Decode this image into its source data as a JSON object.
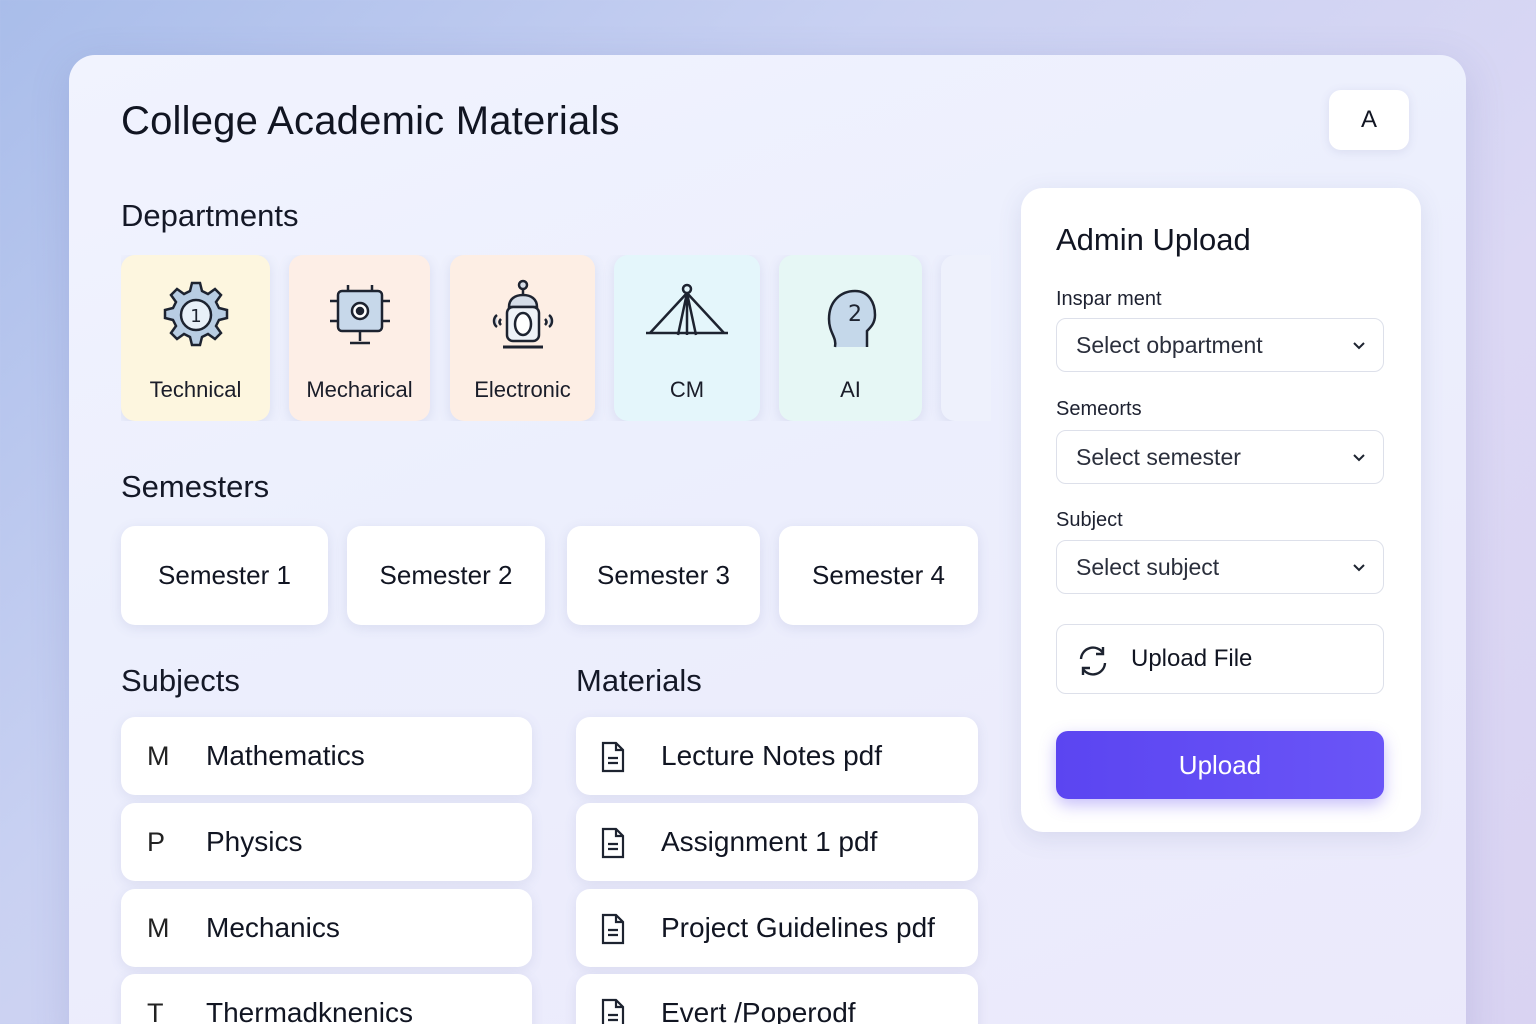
{
  "header": {
    "title": "College Academic Materials",
    "avatar_initial": "A"
  },
  "sections": {
    "departments": "Departments",
    "semesters": "Semesters",
    "subjects": "Subjects",
    "materials": "Materials"
  },
  "departments": [
    {
      "label": "Technical",
      "icon": "gear-icon",
      "bg": "#fdf6df"
    },
    {
      "label": "Mecharical",
      "icon": "machine-icon",
      "bg": "#fdeee6"
    },
    {
      "label": "Electronic",
      "icon": "robot-icon",
      "bg": "#fdeee4"
    },
    {
      "label": "CM",
      "icon": "tripod-icon",
      "bg": "#e4f6fb"
    },
    {
      "label": "AI",
      "icon": "head-icon",
      "bg": "#e6f7f5"
    }
  ],
  "semesters": [
    "Semester 1",
    "Semester 2",
    "Semester 3",
    "Semester 4"
  ],
  "subjects": [
    {
      "letter": "M",
      "name": "Mathematics"
    },
    {
      "letter": "P",
      "name": "Physics"
    },
    {
      "letter": "M",
      "name": "Mechanics"
    },
    {
      "letter": "T",
      "name": "Thermadknenics"
    }
  ],
  "materials": [
    {
      "name": "Lecture Notes pdf",
      "icon": "document-icon"
    },
    {
      "name": "Assignment 1 pdf",
      "icon": "document-icon"
    },
    {
      "name": "Project Guidelines pdf",
      "icon": "document-icon"
    },
    {
      "name": "Evert /Poperodf",
      "icon": "document-icon"
    }
  ],
  "admin": {
    "title": "Admin Upload",
    "department_label": "Inspar ment",
    "department_placeholder": "Select obpartment",
    "semester_label": "Semeorts",
    "semester_placeholder": "Select semester",
    "subject_label": "Subject",
    "subject_placeholder": "Select subject",
    "file_button": "Upload File",
    "upload_button": "Upload"
  },
  "colors": {
    "accent": "#5b45f1"
  }
}
